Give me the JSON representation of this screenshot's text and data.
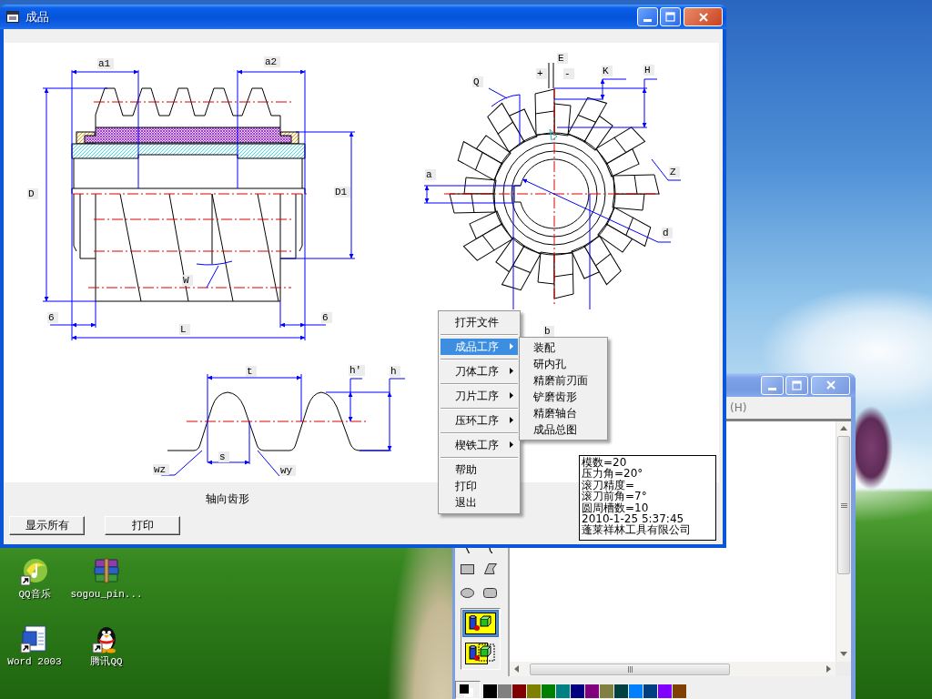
{
  "main_window": {
    "title": "成品",
    "side_view": {
      "labels": [
        "a1",
        "a2",
        "D",
        "D1",
        "6",
        "6",
        "L",
        "W"
      ]
    },
    "end_view": {
      "labels": [
        "E",
        "+",
        "-",
        "K",
        "H",
        "Q",
        "a",
        "Z",
        "d",
        "b"
      ]
    },
    "tooth_profile": {
      "labels": [
        "t",
        "h'",
        "h",
        "s",
        "wz",
        "wy"
      ],
      "caption": "轴向齿形"
    },
    "info_box": {
      "lines": [
        "模数=20",
        "压力角=20°",
        "滚刀精度=",
        "滚刀前角=7°",
        "圆周槽数=10",
        "2010-1-25 5:37:45",
        "蓬莱祥林工具有限公司"
      ]
    },
    "buttons": [
      "显示所有",
      "打印"
    ]
  },
  "context_menu": {
    "groups": [
      [
        {
          "label": "打开文件",
          "kind": "command",
          "selected": false
        }
      ],
      [
        {
          "label": "成品工序",
          "kind": "submenu",
          "selected": true,
          "submenu": [
            {
              "label": "装配",
              "selected": false
            },
            {
              "label": "研内孔",
              "selected": false
            },
            {
              "label": "精磨前刃面",
              "selected": false
            },
            {
              "label": "铲磨齿形",
              "selected": false
            },
            {
              "label": "精磨轴台",
              "selected": false
            },
            {
              "label": "成品总图",
              "selected": false
            }
          ]
        }
      ],
      [
        {
          "label": "刀体工序",
          "kind": "submenu",
          "selected": false
        }
      ],
      [
        {
          "label": "刀片工序",
          "kind": "submenu",
          "selected": false
        }
      ],
      [
        {
          "label": "压环工序",
          "kind": "submenu",
          "selected": false
        }
      ],
      [
        {
          "label": "楔铁工序",
          "kind": "submenu",
          "selected": false
        }
      ],
      [
        {
          "label": "帮助",
          "kind": "command",
          "selected": false
        },
        {
          "label": "打印",
          "kind": "command",
          "selected": false
        },
        {
          "label": "退出",
          "kind": "command",
          "selected": false
        }
      ]
    ]
  },
  "paint_window": {
    "menu_items": [
      "(H)"
    ],
    "fill_options": [
      {
        "selected": true
      },
      {
        "selected": false
      }
    ],
    "foreground": {
      "color": "#000000"
    },
    "background": {
      "color": "#ffffff"
    },
    "palette": [
      {
        "color": "#000000"
      },
      {
        "color": "#808080"
      },
      {
        "color": "#800000"
      },
      {
        "color": "#808000"
      },
      {
        "color": "#008000"
      },
      {
        "color": "#008080"
      },
      {
        "color": "#000080"
      },
      {
        "color": "#800080"
      },
      {
        "color": "#808040"
      },
      {
        "color": "#004040"
      },
      {
        "color": "#0080ff"
      },
      {
        "color": "#004080"
      },
      {
        "color": "#8000ff"
      },
      {
        "color": "#804000"
      }
    ]
  },
  "desktop": {
    "icons": [
      {
        "label": "QQ音乐",
        "shortcut": true
      },
      {
        "label": "sogou_pin...",
        "shortcut": false
      },
      {
        "label": "Word 2003",
        "shortcut": true
      },
      {
        "label": "腾讯QQ",
        "shortcut": true
      }
    ]
  }
}
